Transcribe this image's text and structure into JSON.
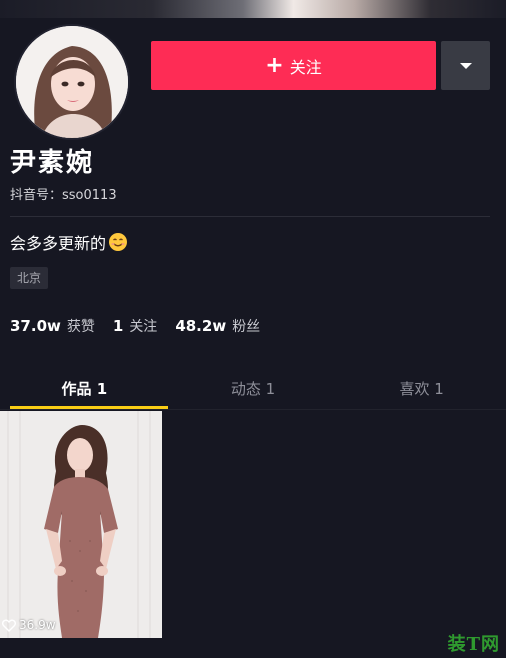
{
  "profile": {
    "name": "尹素婉",
    "douyin_id": "抖音号：sso0113",
    "bio": "会多多更新的",
    "bio_emoji": "smiling-face-icon",
    "location": "北京"
  },
  "actions": {
    "follow_label": "关注",
    "follow_icon": "plus-icon",
    "more_icon": "caret-down-icon"
  },
  "stats": [
    {
      "value": "37.0w",
      "label": "获赞"
    },
    {
      "value": "1",
      "label": "关注"
    },
    {
      "value": "48.2w",
      "label": "粉丝"
    }
  ],
  "tabs": [
    {
      "label": "作品 1",
      "active": true
    },
    {
      "label": "动态 1",
      "active": false
    },
    {
      "label": "喜欢 1",
      "active": false
    }
  ],
  "videos": [
    {
      "likes": "36.9w",
      "like_icon": "heart-outline-icon"
    }
  ],
  "watermark": "装T网",
  "colors": {
    "background": "#161722",
    "follow_button": "#fe2c55",
    "more_button": "#393b44",
    "tab_indicator": "#face15"
  }
}
